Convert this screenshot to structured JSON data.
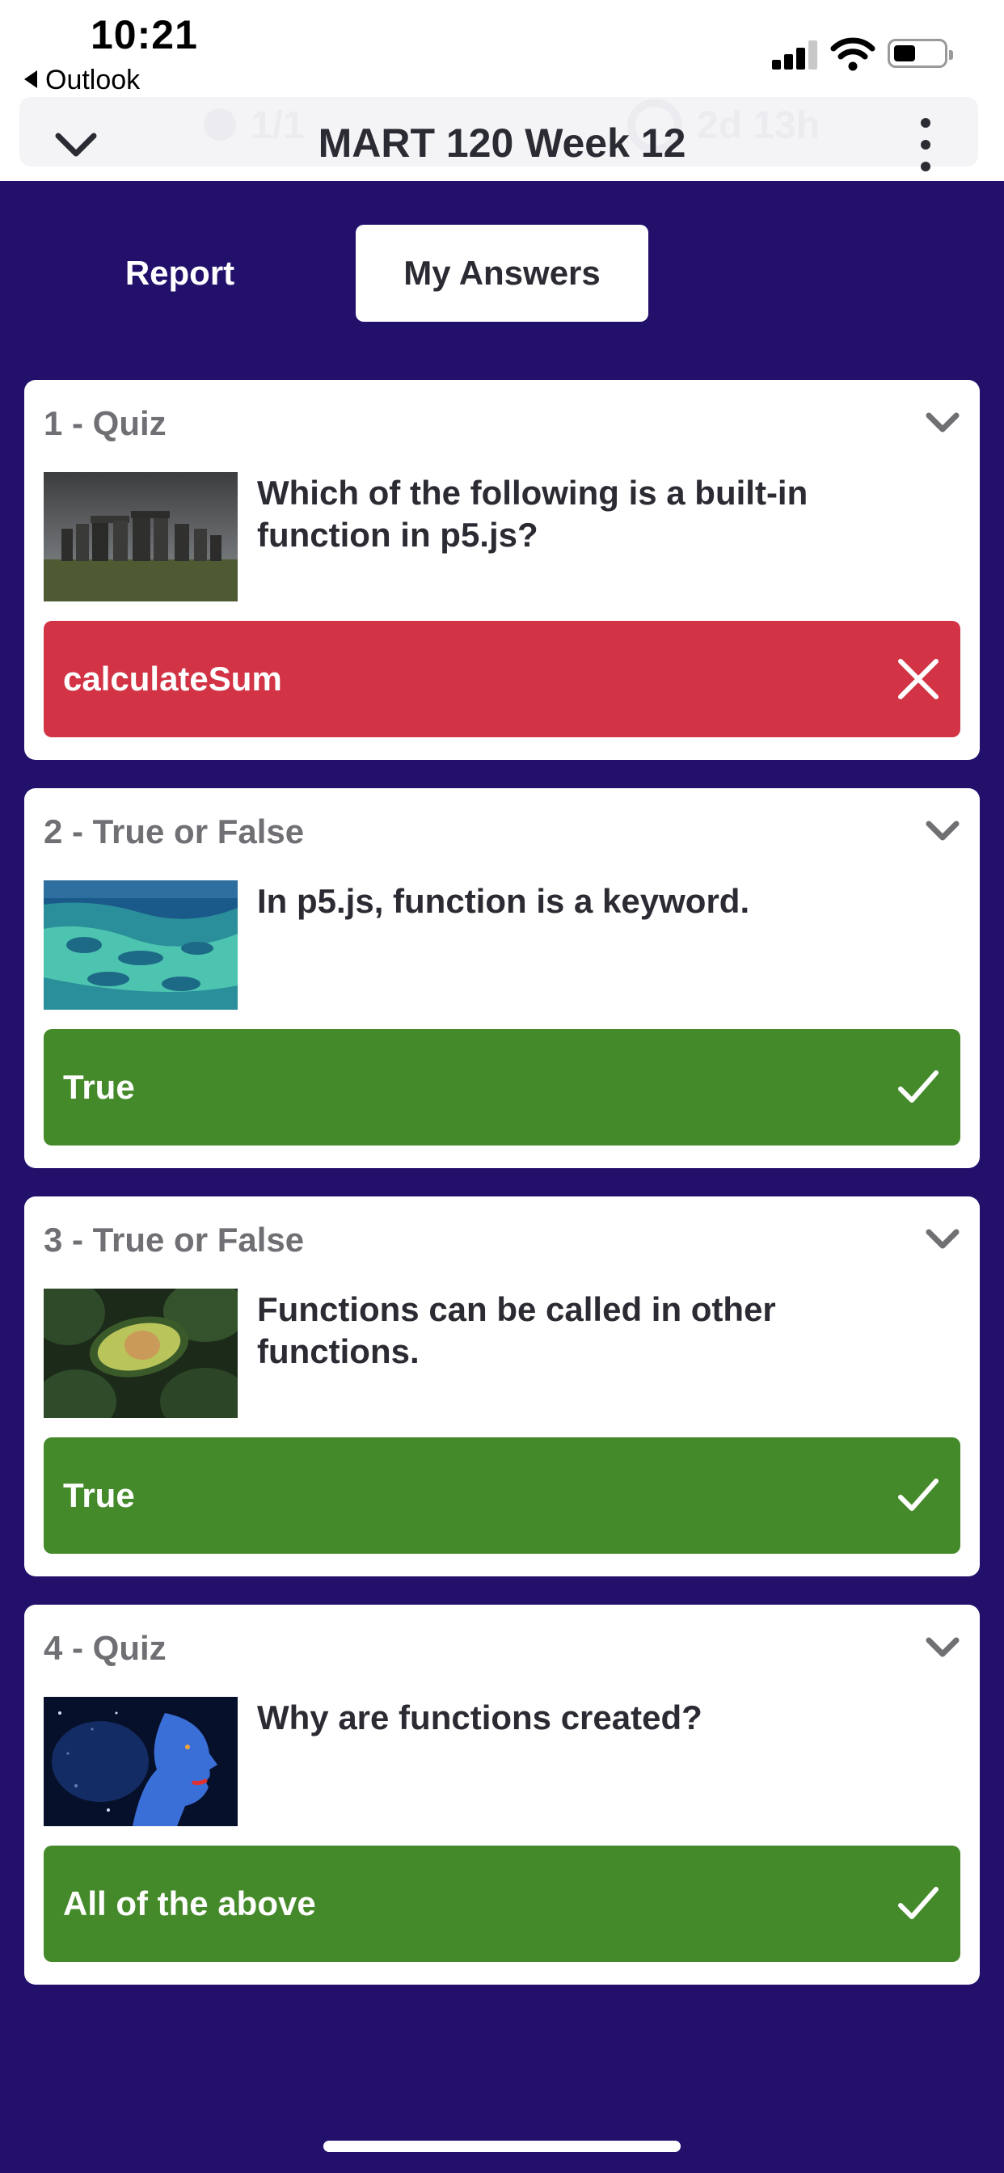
{
  "status_bar": {
    "time": "10:21",
    "back_app": "Outlook"
  },
  "header": {
    "title": "MART 120 Week 12",
    "behind_user_count": "1/1",
    "behind_time_left": "2d 13h"
  },
  "tabs": [
    {
      "label": "Report",
      "active": false
    },
    {
      "label": "My Answers",
      "active": true
    }
  ],
  "questions": [
    {
      "header": "1 - Quiz",
      "text": "Which of the following is a built-in function in p5.js?",
      "image": "stonehenge-thumbnail",
      "answer": "calculateSum",
      "correct": false
    },
    {
      "header": "2 - True or False",
      "text": "In p5.js, function is a keyword.",
      "image": "reef-thumbnail",
      "answer": "True",
      "correct": true
    },
    {
      "header": "3 - True or False",
      "text": "Functions can be called in other functions.",
      "image": "avocado-thumbnail",
      "answer": "True",
      "correct": true
    },
    {
      "header": "4 - Quiz",
      "text": "Why are functions created?",
      "image": "galaxy-face-thumbnail",
      "answer": "All of the above",
      "correct": true
    }
  ],
  "colors": {
    "background": "#22106b",
    "wrong": "#d23445",
    "correct": "#458a2a"
  }
}
